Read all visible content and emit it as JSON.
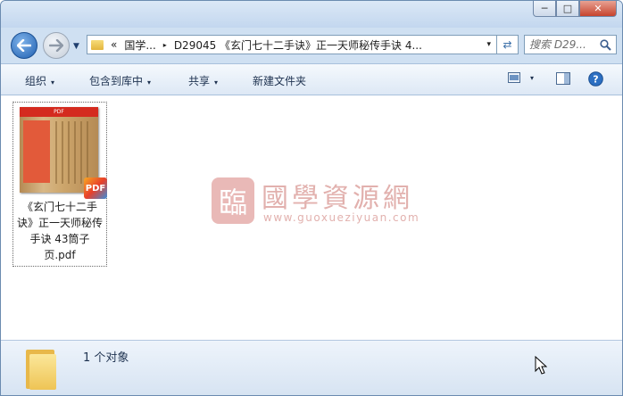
{
  "window": {
    "minimize_label": "─",
    "maximize_label": "□",
    "close_label": "✕"
  },
  "address": {
    "collapsed_crumb": "«",
    "crumb_1": "国学...",
    "crumb_2": "D29045 《玄门七十二手诀》正一天师秘传手诀 4...",
    "separator": "▸",
    "dropdown_glyph": "▾"
  },
  "search": {
    "placeholder": "搜索 D29...",
    "icon": "magnifier-icon"
  },
  "toolbar": {
    "organize": "组织",
    "include_in_library": "包含到库中",
    "share": "共享",
    "new_folder": "新建文件夹",
    "dropdown_glyph": "▾"
  },
  "files": [
    {
      "name": "《玄门七十二手诀》正一天师秘传手诀 43筒子页.pdf",
      "type": "pdf",
      "badge": "PDF",
      "thumbnail_band": "PDF",
      "selected": true
    }
  ],
  "watermark": {
    "seal": "臨",
    "title": "國學資源網",
    "url": "www.guoxueziyuan.com"
  },
  "status": {
    "item_count": "1 个对象"
  },
  "colors": {
    "accent": "#1f5fb0",
    "close": "#c6432d",
    "watermark": "#e2b1ae"
  }
}
